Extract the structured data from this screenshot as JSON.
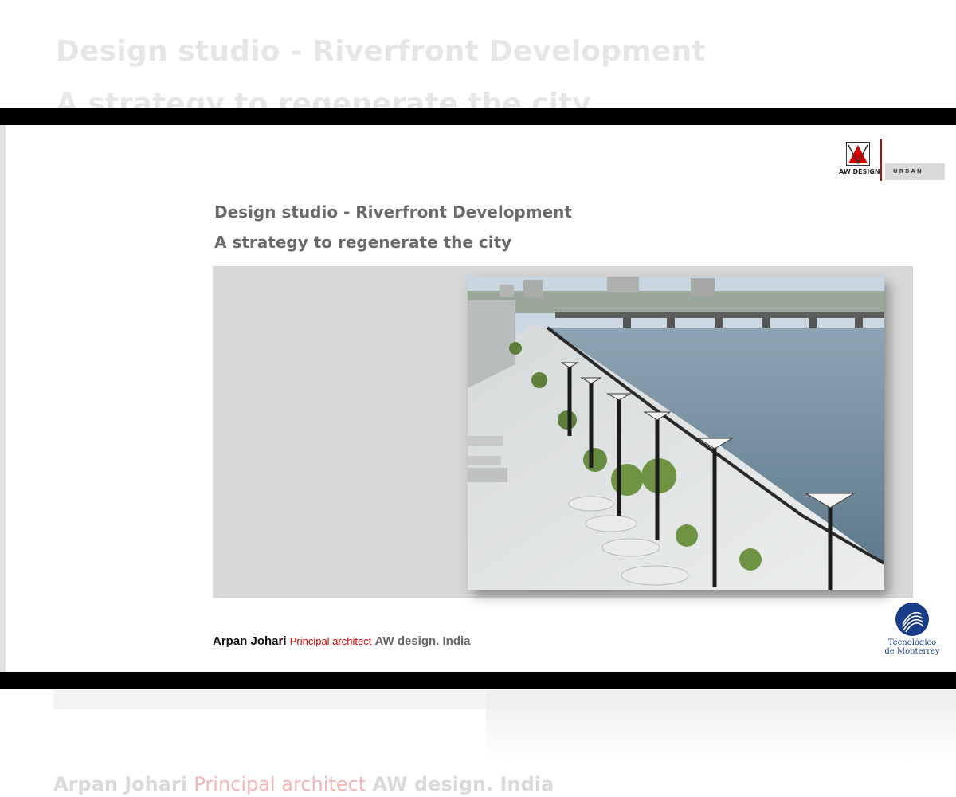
{
  "background": {
    "title": "Design studio - Riverfront Development",
    "subtitle": "A strategy to regenerate the city",
    "footer": {
      "name": "Arpan Johari",
      "role": "Principal architect",
      "org": "AW design. India"
    }
  },
  "slide": {
    "logo": {
      "brand": "AW DESIGN",
      "division": "URBAN"
    },
    "title": "Design studio - Riverfront Development",
    "subtitle": "A strategy to regenerate the city",
    "footer": {
      "name": "Arpan Johari",
      "role": "Principal architect",
      "org": "AW design. India"
    },
    "institution": {
      "line1": "Tecnológico",
      "line2": "de Monterrey"
    }
  },
  "colors": {
    "accent_red": "#d40000",
    "title_gray": "#6a6a6a",
    "panel_gray": "#d7d7d7",
    "tec_blue": "#1a3d8a"
  }
}
